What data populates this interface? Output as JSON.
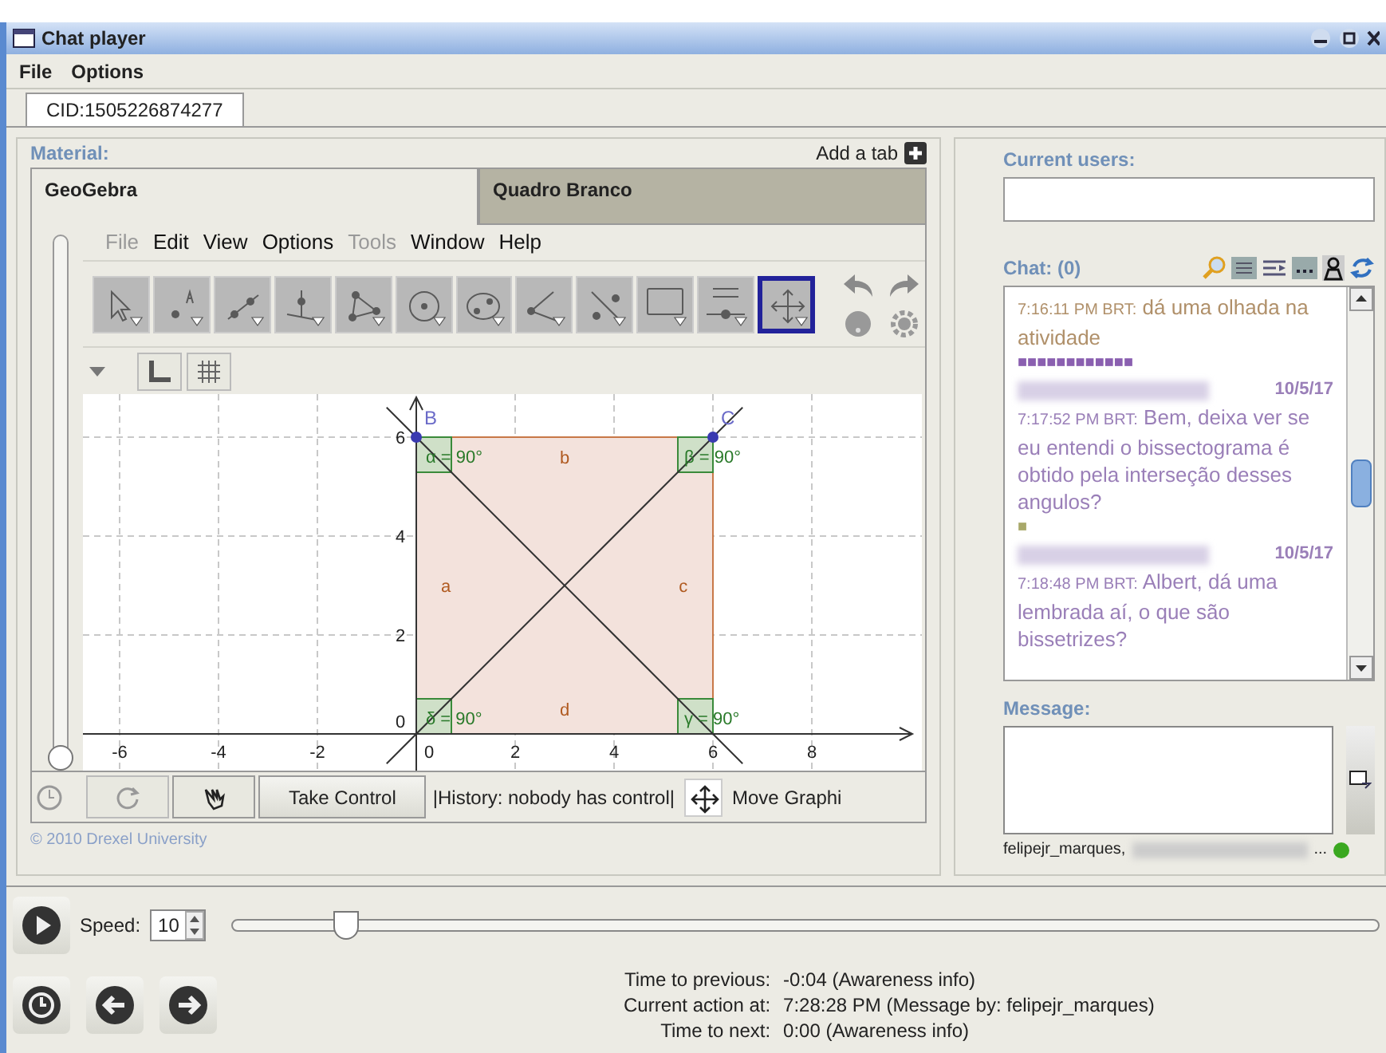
{
  "window": {
    "title": "Chat player"
  },
  "menu": [
    "File",
    "Options"
  ],
  "session_tabs": [
    {
      "label": "CID:1505226874277",
      "selected": true
    }
  ],
  "material": {
    "label": "Material:",
    "add_tab": "Add a tab",
    "tabs": [
      {
        "label": "GeoGebra",
        "selected": true
      },
      {
        "label": "Quadro Branco",
        "selected": false
      }
    ]
  },
  "geogebra": {
    "menu": [
      {
        "label": "File",
        "disabled": true
      },
      {
        "label": "Edit",
        "disabled": false
      },
      {
        "label": "View",
        "disabled": false
      },
      {
        "label": "Options",
        "disabled": false
      },
      {
        "label": "Tools",
        "disabled": true
      },
      {
        "label": "Window",
        "disabled": false
      },
      {
        "label": "Help",
        "disabled": false
      }
    ],
    "tools": [
      {
        "kind": "pointer",
        "selected": false
      },
      {
        "kind": "point",
        "selected": false
      },
      {
        "kind": "line",
        "selected": false
      },
      {
        "kind": "perpendicular",
        "selected": false
      },
      {
        "kind": "polygon",
        "selected": false
      },
      {
        "kind": "circle",
        "selected": false
      },
      {
        "kind": "ellipse",
        "selected": false
      },
      {
        "kind": "angle",
        "selected": false
      },
      {
        "kind": "reflect",
        "selected": false
      },
      {
        "kind": "text",
        "selected": false
      },
      {
        "kind": "slider",
        "selected": false
      },
      {
        "kind": "move",
        "selected": true
      }
    ],
    "style_buttons": [
      {
        "kind": "axes",
        "selected": false
      },
      {
        "kind": "grid",
        "selected": false
      }
    ],
    "zoom_slider": {
      "level": 0
    },
    "graph": {
      "x_ticks": [
        "-6",
        "-4",
        "-2",
        "0",
        "2",
        "4",
        "6",
        "8"
      ],
      "y_ticks": [
        "6",
        "4",
        "2",
        "0"
      ],
      "points": [
        {
          "label": "B"
        },
        {
          "label": "C"
        }
      ],
      "sides": [
        {
          "label": "b"
        },
        {
          "label": "a"
        },
        {
          "label": "c"
        },
        {
          "label": "d"
        }
      ],
      "angles": [
        {
          "label": "α = 90°"
        },
        {
          "label": "β = 90°"
        },
        {
          "label": "δ = 90°"
        },
        {
          "label": "γ = 90°"
        }
      ]
    },
    "controls": {
      "take_control": "Take Control",
      "history": "|History: nobody has control|",
      "mode": "Move Graphi"
    },
    "copyright": "© 2010 Drexel University"
  },
  "users": {
    "label": "Current users:"
  },
  "chat": {
    "label": "Chat: (0)",
    "messages": [
      {
        "kind": "continued",
        "time": "7:16:11 PM BRT:",
        "text": "dá uma olhada na atividade",
        "color": "#b0906a"
      },
      {
        "kind": "marker",
        "text": "■■■■■■■■■■■■",
        "color": "#8a5fb0"
      },
      {
        "kind": "hidden-author",
        "date": "10/5/17",
        "time": "7:17:52 PM BRT:",
        "text": "Bem, deixa ver se eu entendi o bissectograma é obtido pela interseção desses angulos?",
        "color": "#9a7fb8"
      },
      {
        "kind": "marker",
        "text": "■",
        "color": "#a8a86a"
      },
      {
        "kind": "hidden-author",
        "date": "10/5/17",
        "time": "7:18:48 PM BRT:",
        "text": "Albert, dá uma lembrada aí, o que são bissetrizes?",
        "color": "#9a7fb8"
      }
    ]
  },
  "message": {
    "label": "Message:",
    "status": "felipejr_marques,",
    "status_end": "..."
  },
  "playback": {
    "speed_label": "Speed:",
    "speed": "10",
    "level": 0.1,
    "info": [
      {
        "label": "Time to previous:",
        "value": "-0:04 (Awareness info)"
      },
      {
        "label": "Current action at:",
        "value": "7:28:28 PM (Message by: felipejr_marques)"
      },
      {
        "label": "Time to next:",
        "value": "0:00 (Awareness info)"
      }
    ]
  }
}
